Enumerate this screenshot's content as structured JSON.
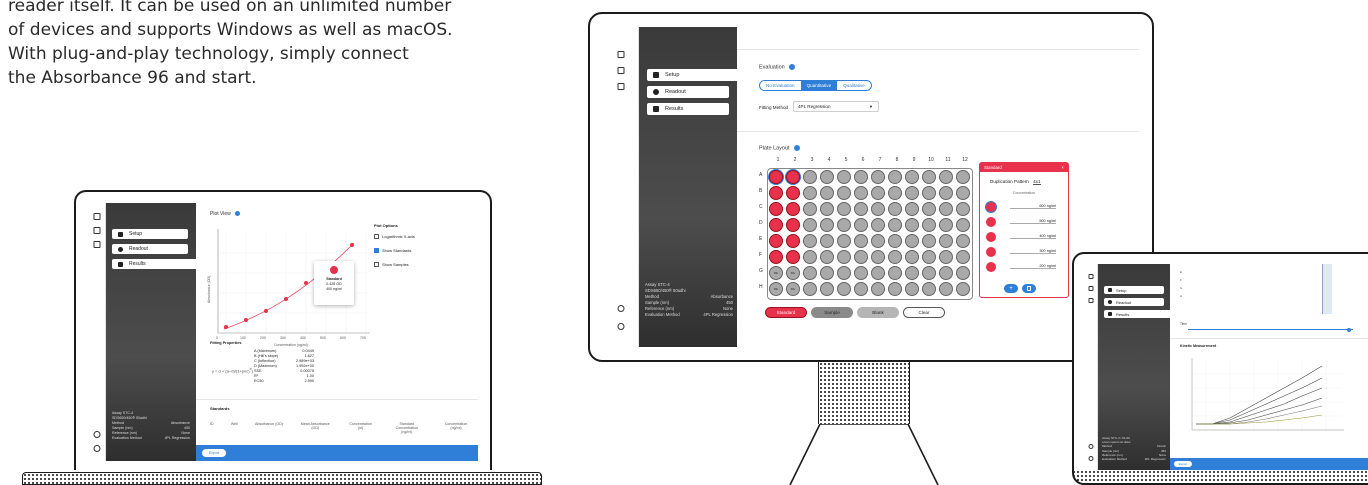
{
  "intro": {
    "lines": [
      "reader itself. It can be used on an unlimited number",
      "of devices and supports Windows as well as macOS.",
      "With plug-and-play technology, simply connect",
      "the Absorbance 96 and start."
    ]
  },
  "nav": {
    "setup": "Setup",
    "readout": "Readout",
    "results": "Results"
  },
  "laptop": {
    "plot_view": "Plot View",
    "plot_options": "Plot Options",
    "options": [
      "Logarithmic X-axis",
      "Show Standards",
      "Show Samples"
    ],
    "tooltip": {
      "title": "Standard",
      "value": "0.426 OD",
      "conc": "400 ng/ml"
    },
    "x_axis_label": "Concentration (ng/ml)",
    "y_axis_label": "Absorbance (OD)",
    "x_ticks": [
      "0",
      "100",
      "200",
      "300",
      "400",
      "500",
      "600",
      "700"
    ],
    "fitting_properties": "Fitting Properties",
    "fit_rows": [
      [
        "A (Maximum)",
        "0.0449"
      ],
      [
        "B (Hill's slope)",
        "1.627"
      ],
      [
        "C (Inflection)",
        "2.989e+03"
      ],
      [
        "D (Maximum)",
        "1.992e+00"
      ],
      [
        "SSE",
        "0.00075"
      ],
      [
        "R²",
        "1.00"
      ],
      [
        "EC50",
        "2.990"
      ]
    ],
    "standards": "Standards",
    "std_cols": [
      "ID",
      "Well",
      "Absorbance (OD)",
      "Mean Absorbance (OD)",
      "Concentration (ul)",
      "Standard Concentration (ng/ml)",
      "Concentration (ng/ml)"
    ],
    "assay": {
      "name": "Assay STC-4",
      "sub": "SDS650/450® 50adhi",
      "rows": [
        [
          "Method",
          "Absorbance"
        ],
        [
          "Sample (nm)",
          "450"
        ],
        [
          "Reference (nm)",
          "None"
        ],
        [
          "Evaluation Method",
          "4PL Regression"
        ]
      ]
    },
    "export": "Export"
  },
  "monitor": {
    "evaluation": "Evaluation",
    "eval_options": [
      "No Evaluation",
      "Quantitative",
      "Qualitative"
    ],
    "eval_selected": "Quantitative",
    "fitting_method_label": "Fitting Method",
    "fitting_method_value": "4PL Regression",
    "plate_layout": "Plate Layout",
    "columns": [
      "1",
      "2",
      "3",
      "4",
      "5",
      "6",
      "7",
      "8",
      "9",
      "10",
      "11",
      "12"
    ],
    "rows": [
      "A",
      "B",
      "C",
      "D",
      "E",
      "F",
      "G",
      "H"
    ],
    "blank_label": "Blk",
    "standard_panel": {
      "title": "Standard",
      "duplication_label": "Duplication Pattern",
      "duplication_value": "4x1",
      "concentration": "Concentration",
      "values": [
        "600 ng/ml",
        "500 ng/ml",
        "400 ng/ml",
        "300 ng/ml",
        "200 ng/ml"
      ]
    },
    "buttons": [
      "Standard",
      "Sample",
      "Blank",
      "Clear"
    ],
    "assay": {
      "name": "Assay STC-4",
      "sub": "SDS650/450® 50adhi",
      "rows": [
        [
          "Method",
          "Absorbance"
        ],
        [
          "Sample (nm)",
          "450"
        ],
        [
          "Reference (nm)",
          "None"
        ],
        [
          "Evaluation Method",
          "4PL Regression"
        ]
      ]
    }
  },
  "tablet": {
    "time": "Time",
    "kinetic": "Kinetic Measurement",
    "assay": {
      "name": "Assay STC-4 / 01-00",
      "sub": "Lorem ipsum sit dolor",
      "rows": [
        [
          "Method",
          "Kinetic"
        ],
        [
          "Sample (nm)",
          "450"
        ],
        [
          "Reference (nm)",
          "None"
        ],
        [
          "Evaluation Method",
          "4PL Regression"
        ]
      ]
    },
    "export": "Export"
  },
  "colors": {
    "accent": "#2f7fd8",
    "red": "#e8314a",
    "sidebar": "#3f3f3f"
  }
}
